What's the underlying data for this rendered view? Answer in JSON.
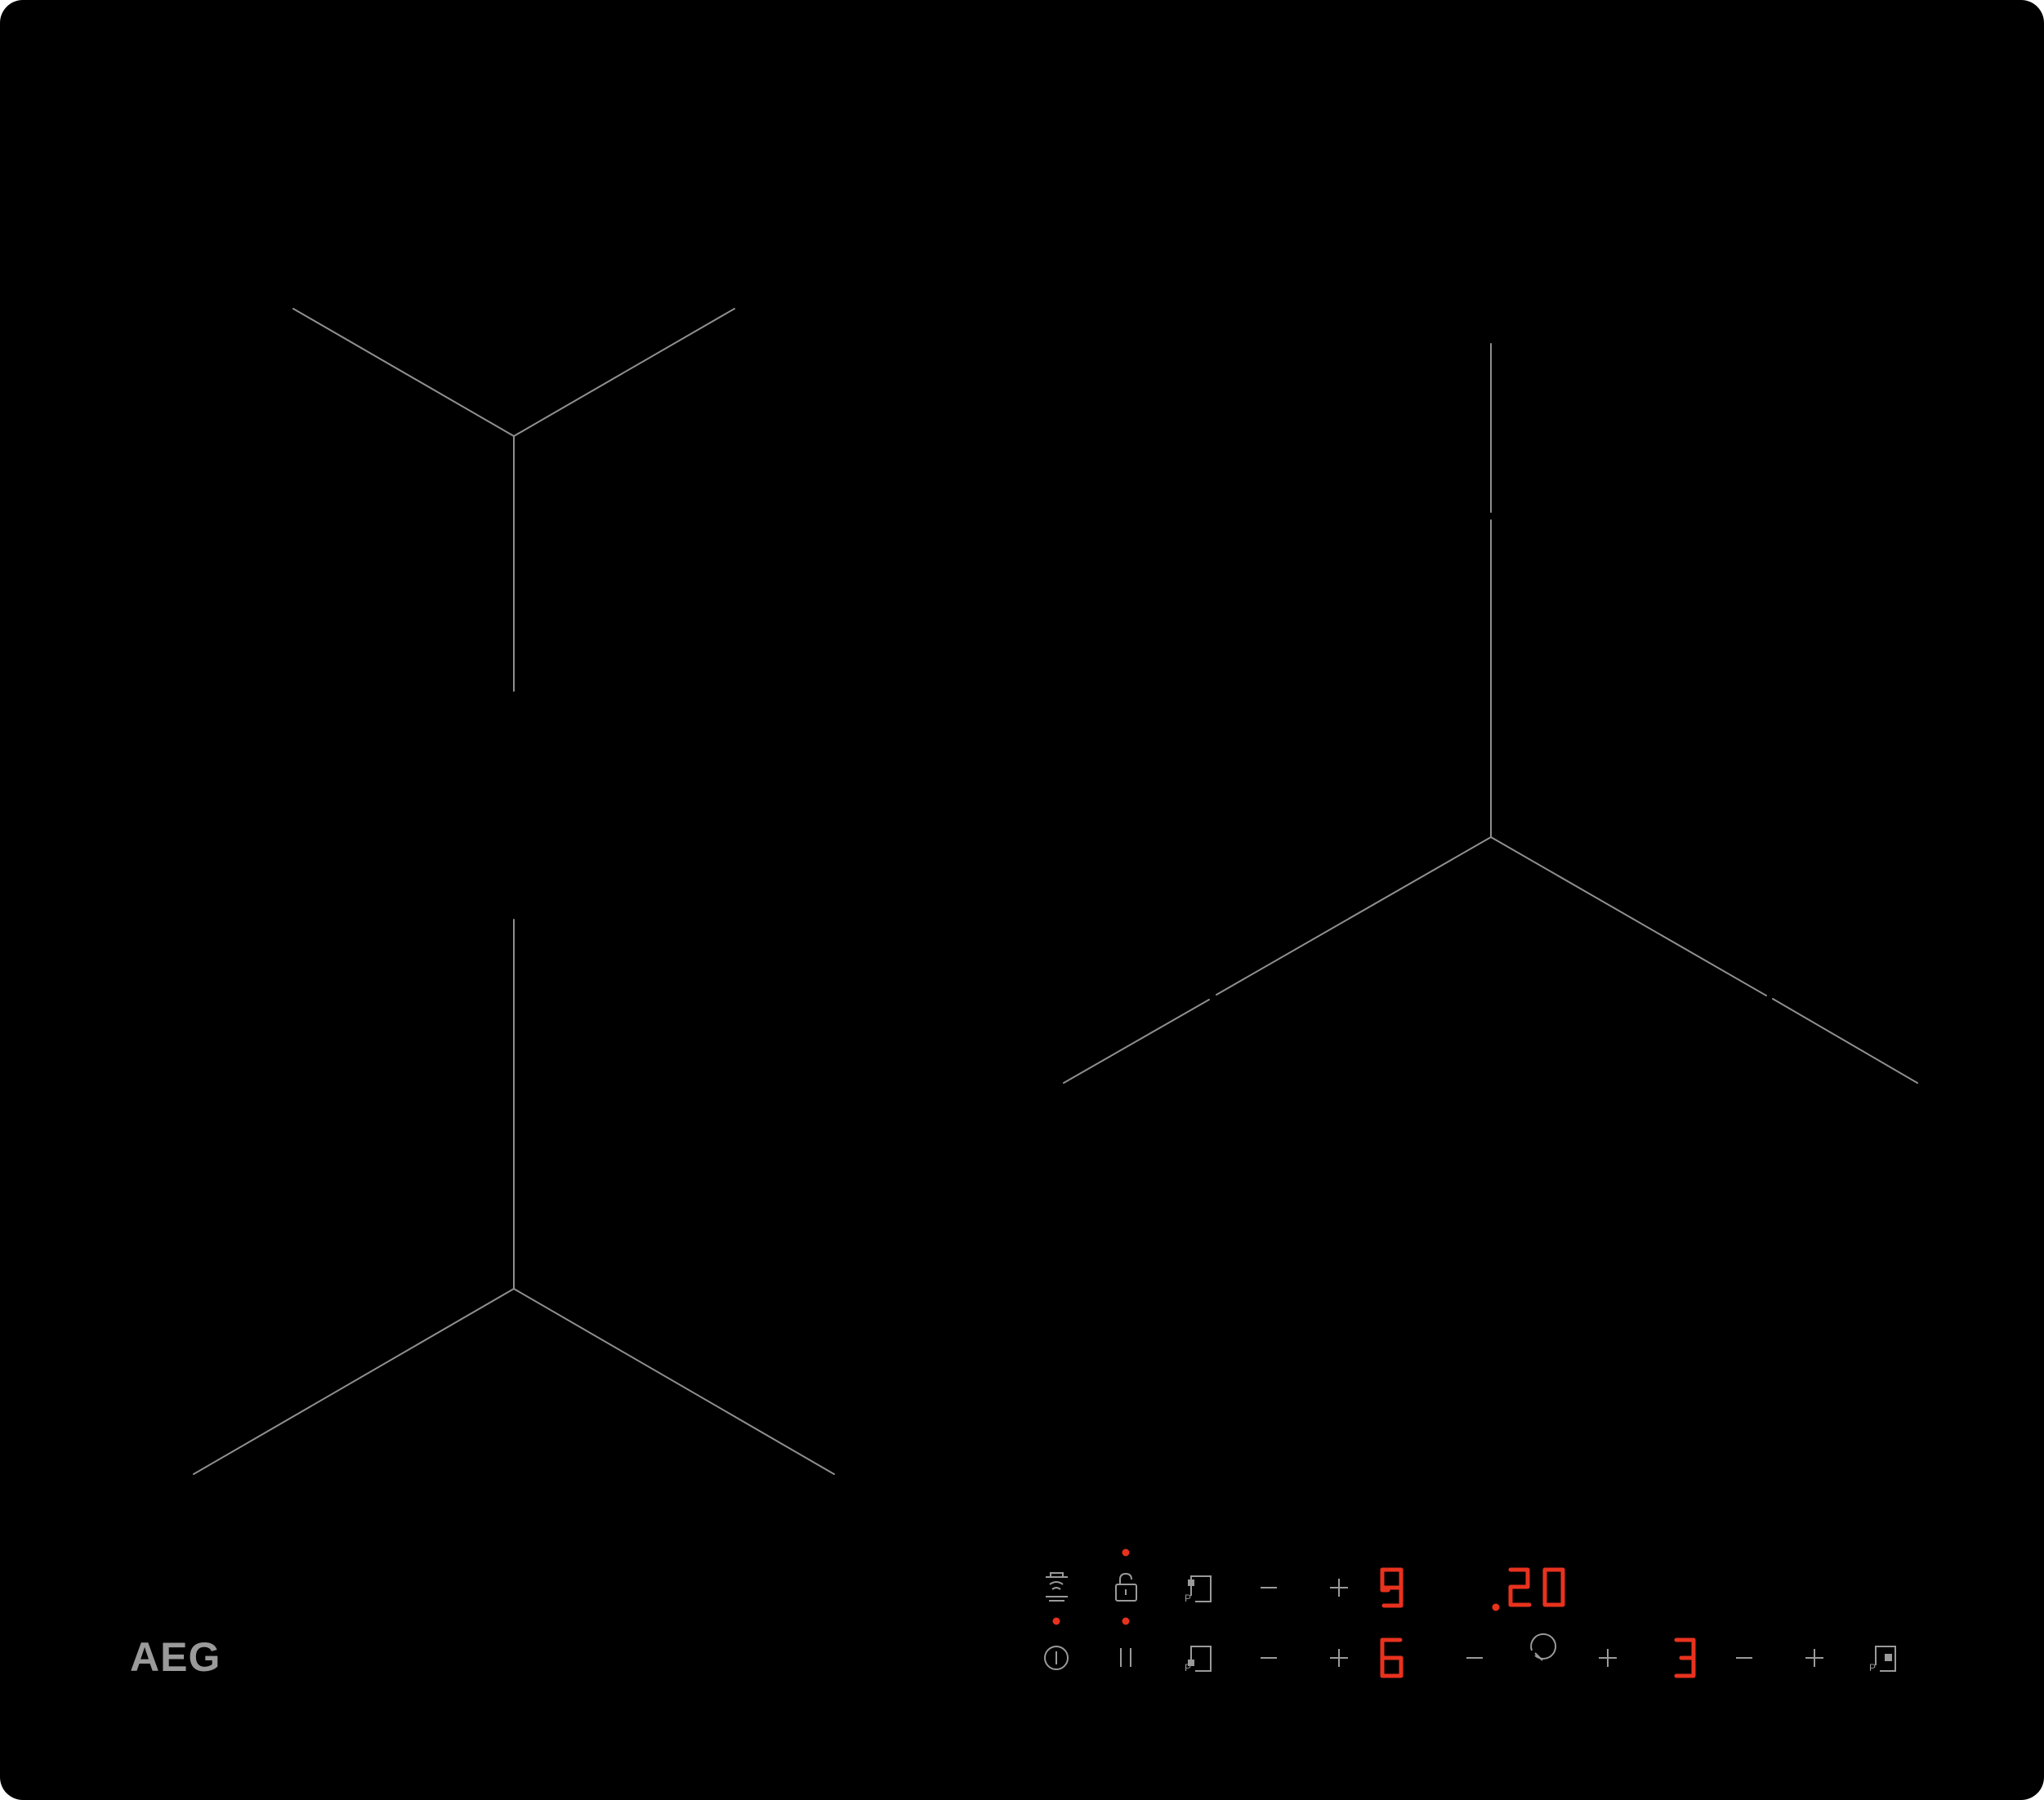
{
  "brand": {
    "logo_text": "AEG"
  },
  "colors": {
    "glass": "#000000",
    "marking_lines": "#8f8f8f",
    "control_symbols": "#9a9a9a",
    "display_digits": "#e8321e",
    "indicator_dots": "#e8321e",
    "logo": "#9a9a9a"
  },
  "cooking_zones": [
    {
      "id": "rear-left"
    },
    {
      "id": "front-left"
    },
    {
      "id": "right"
    }
  ],
  "control_panel": {
    "top_row": [
      {
        "name": "hob2hood-button",
        "icon": "hob2hood-icon",
        "indicator_on": true
      },
      {
        "name": "lock-button",
        "icon": "lock-icon",
        "indicator_on": true
      },
      {
        "name": "zone-select-rear-left-button",
        "icon": "zone-rear-left-icon"
      },
      {
        "name": "power-minus-rear-left-button",
        "label": "–"
      },
      {
        "name": "power-plus-rear-left-button",
        "label": "+"
      },
      {
        "name": "power-level-rear-left-display",
        "display": "9"
      },
      {
        "name": "timer-display",
        "display": "20",
        "decimal_point_on": true
      }
    ],
    "bottom_row": [
      {
        "name": "on-off-button",
        "icon": "power-icon"
      },
      {
        "name": "stopgo-button",
        "icon": "pause-icon",
        "indicator_on": true
      },
      {
        "name": "zone-select-front-left-button",
        "icon": "zone-front-left-icon"
      },
      {
        "name": "power-minus-front-left-button",
        "label": "–"
      },
      {
        "name": "power-plus-front-left-button",
        "label": "+"
      },
      {
        "name": "power-level-front-left-display",
        "display": "6"
      },
      {
        "name": "timer-minus-button",
        "label": "–"
      },
      {
        "name": "timer-button",
        "icon": "timer-icon"
      },
      {
        "name": "timer-plus-button",
        "label": "+"
      },
      {
        "name": "power-level-right-display",
        "display": "3"
      },
      {
        "name": "power-minus-right-button",
        "label": "–"
      },
      {
        "name": "power-plus-right-button",
        "label": "+"
      },
      {
        "name": "zone-select-right-button",
        "icon": "zone-right-icon"
      }
    ]
  }
}
